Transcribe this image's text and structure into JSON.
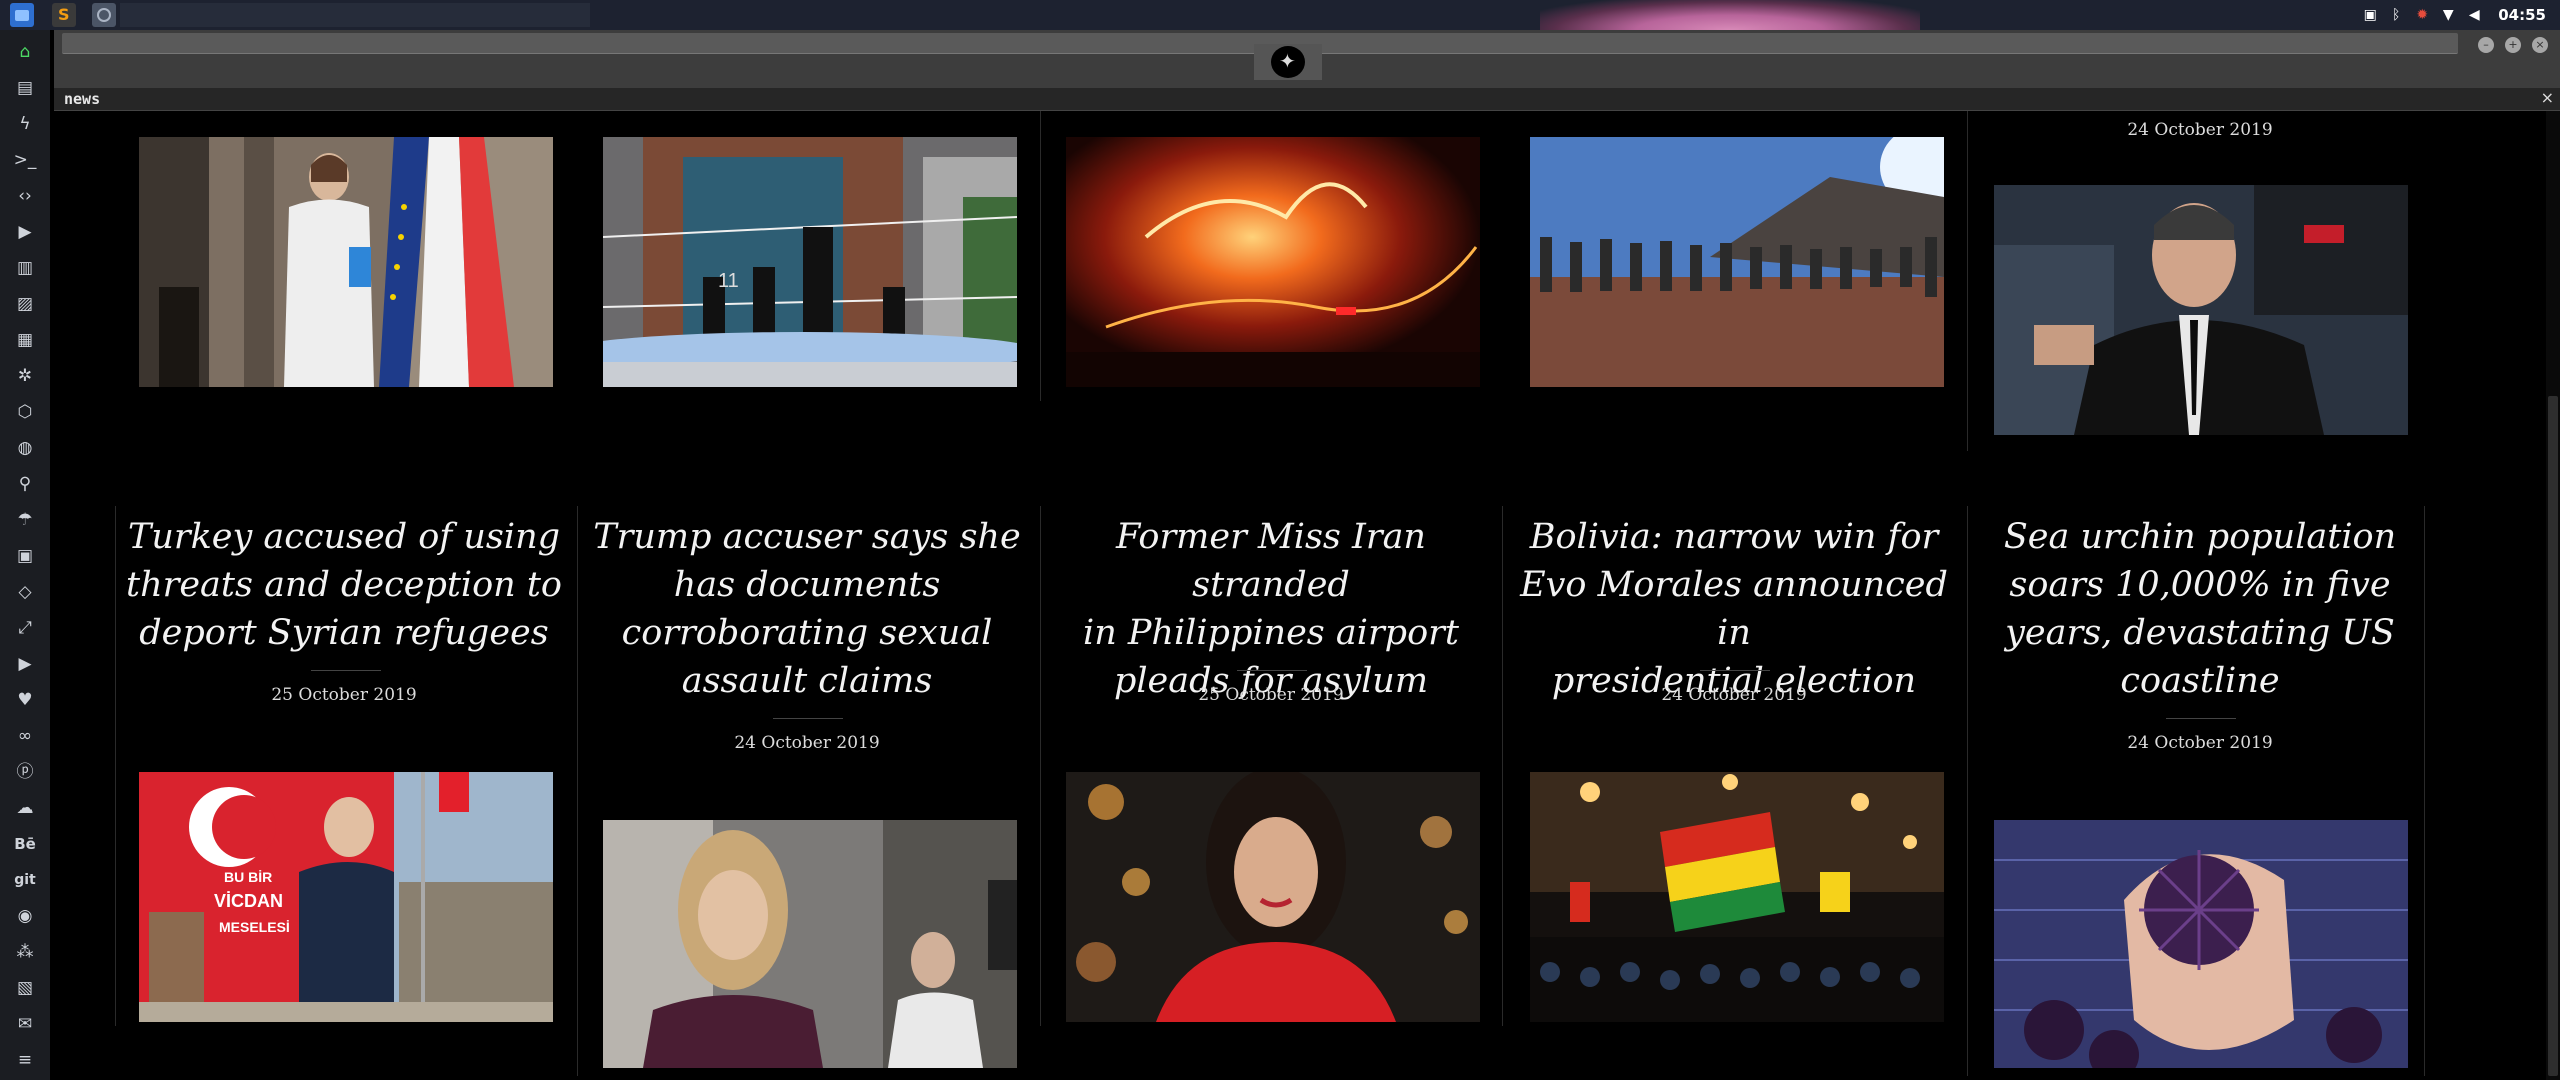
{
  "system": {
    "clock": "04:55",
    "tray_icons": [
      "image-icon",
      "bluetooth-icon",
      "debug-icon",
      "wifi-icon",
      "volume-icon"
    ]
  },
  "window": {
    "tab_title": "news",
    "close_glyph": "×"
  },
  "dock": {
    "items": [
      "home-icon",
      "file-icon",
      "bolt-icon",
      "terminal-icon",
      "code-icon",
      "play-icon",
      "document-icon",
      "image-icon",
      "newspaper-icon",
      "settings-icon",
      "hexagon-icon",
      "globe-icon",
      "search-icon",
      "umbrella-icon",
      "contact-icon",
      "tag-icon",
      "fullscreen-icon",
      "youtube-icon",
      "heart-icon",
      "link-icon",
      "pinterest-icon",
      "cloud-icon",
      "behance-icon",
      "git-icon",
      "github-icon",
      "cubes-icon",
      "map-icon",
      "mail-icon",
      "server-icon"
    ]
  },
  "news": {
    "top_row": [
      {
        "image": "woman-white-coat-eu-flags",
        "date": ""
      },
      {
        "image": "police-cordon-building",
        "date": ""
      },
      {
        "image": "wildfire-night",
        "date": ""
      },
      {
        "image": "queue-desert-hills",
        "date": ""
      },
      {
        "image": "harvey-weinstein-car",
        "date": "24 October 2019"
      }
    ],
    "articles": [
      {
        "headline_lines": [
          "Turkey accused of using",
          "threats and deception to",
          "deport Syrian refugees"
        ],
        "date": "25 October 2019",
        "image": "erdogan-poster-refugee-camp"
      },
      {
        "headline_lines": [
          "Trump accuser says she",
          "has documents",
          "corroborating sexual",
          "assault claims"
        ],
        "date": "24 October 2019",
        "image": "woman-blonde-street"
      },
      {
        "headline_lines": [
          "Former Miss Iran stranded",
          "in Philippines airport",
          "pleads for asylum"
        ],
        "date": "25 October 2019",
        "image": "woman-red-dress-bokeh"
      },
      {
        "headline_lines": [
          "Bolivia: narrow win for",
          "Evo Morales announced in",
          "presidential election"
        ],
        "date": "24 October 2019",
        "image": "crowd-bolivian-flags"
      },
      {
        "headline_lines": [
          "Sea urchin population",
          "soars 10,000% in five",
          "years, devastating US",
          "coastline"
        ],
        "date": "24 October 2019",
        "image": "hand-holding-sea-urchin"
      }
    ]
  }
}
